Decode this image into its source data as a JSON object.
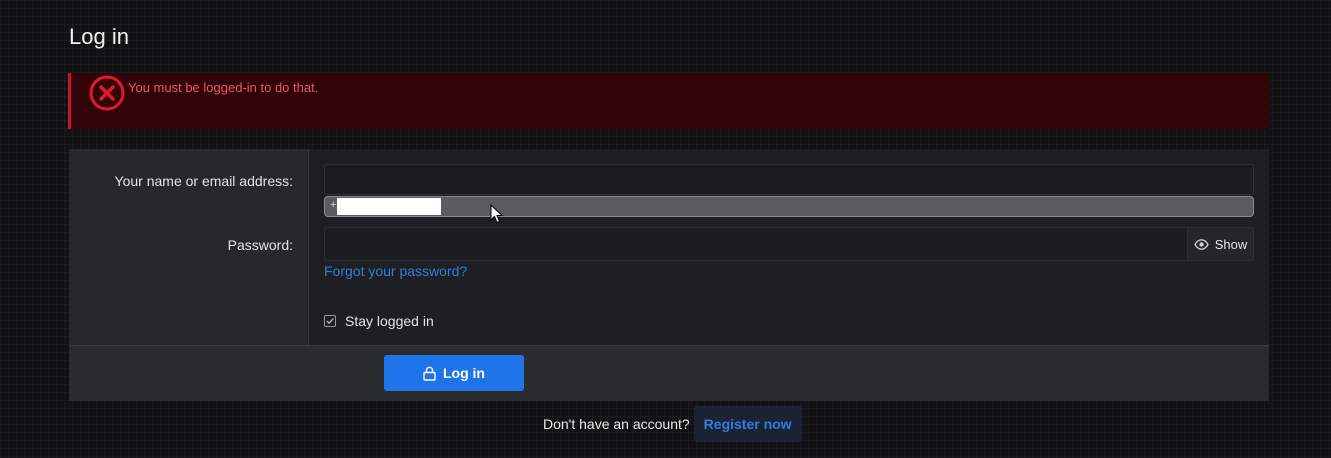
{
  "page": {
    "title": "Log in"
  },
  "error": {
    "message": "You must be logged-in to do that.",
    "icon": "error-x-icon",
    "color": "#c01826"
  },
  "form": {
    "username_label": "Your name or email address:",
    "username_value": "",
    "autocomplete_prefix": "+",
    "password_label": "Password:",
    "password_value": "",
    "show_label": "Show",
    "forgot_password": "Forgot your password?",
    "stay_logged_in_label": "Stay logged in",
    "stay_logged_in_checked": true,
    "submit_label": "Log in"
  },
  "register": {
    "prompt": "Don't have an account?",
    "button_label": "Register now"
  },
  "colors": {
    "accent": "#1f74ea",
    "link": "#2f7de1",
    "error_bg": "#320308"
  }
}
